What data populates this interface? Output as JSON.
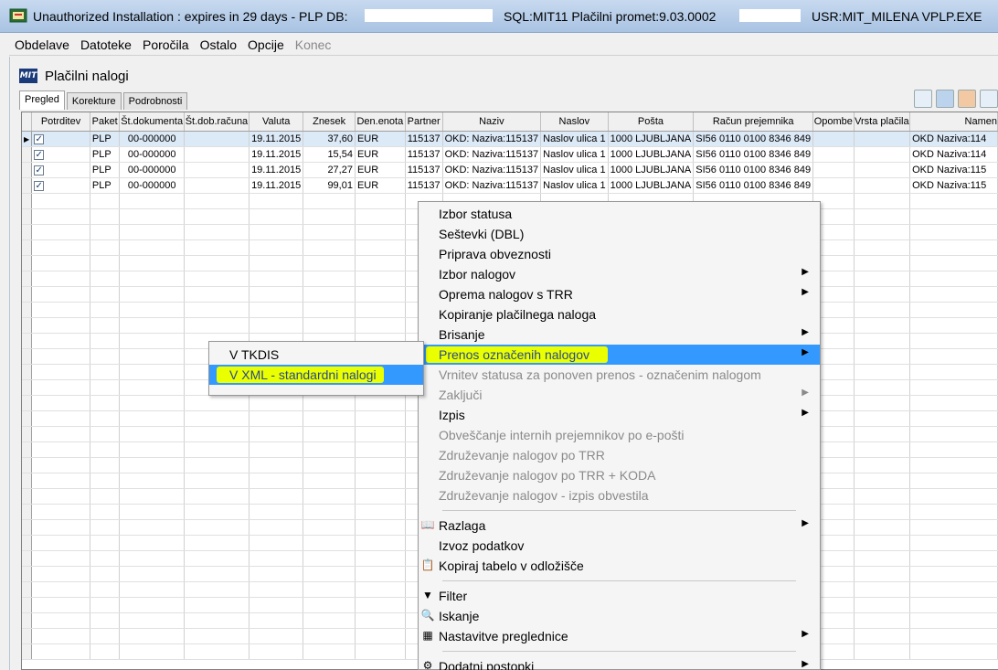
{
  "titlebar": {
    "title": "Unauthorized Installation : expires in 29 days - PLP   DB:",
    "sql": "SQL:MIT11   Plačilni promet:9.03.0002",
    "usr": "USR:MIT_MILENA   VPLP.EXE"
  },
  "menubar": [
    "Obdelave",
    "Datoteke",
    "Poročila",
    "Ostalo",
    "Opcije",
    "Konec"
  ],
  "window": {
    "logo": "MIT",
    "title": "Plačilni nalogi"
  },
  "tabs": [
    "Pregled",
    "Korekture",
    "Podrobnosti"
  ],
  "grid": {
    "columns": [
      "Potrditev",
      "Paket",
      "Št.dokumenta",
      "Št.dob.računa",
      "Valuta",
      "Znesek",
      "Den.enota",
      "Partner",
      "Naziv",
      "Naslov",
      "Pošta",
      "Račun prejemnika",
      "Opombe",
      "Vrsta plačila",
      "Namen"
    ],
    "rows": [
      [
        "✓",
        "PLP",
        "00-000000",
        "",
        "19.11.2015",
        "37,60",
        "EUR",
        "115137",
        "OKD: Naziva:115137",
        "Naslov ulica 1",
        "1000 LJUBLJANA",
        "SI56 0110 0100 8346 849",
        "",
        "",
        "OKD Naziva:114"
      ],
      [
        "✓",
        "PLP",
        "00-000000",
        "",
        "19.11.2015",
        "15,54",
        "EUR",
        "115137",
        "OKD: Naziva:115137",
        "Naslov ulica 1",
        "1000 LJUBLJANA",
        "SI56 0110 0100 8346 849",
        "",
        "",
        "OKD Naziva:114"
      ],
      [
        "✓",
        "PLP",
        "00-000000",
        "",
        "19.11.2015",
        "27,27",
        "EUR",
        "115137",
        "OKD: Naziva:115137",
        "Naslov ulica 1",
        "1000 LJUBLJANA",
        "SI56 0110 0100 8346 849",
        "",
        "",
        "OKD Naziva:115"
      ],
      [
        "✓",
        "PLP",
        "00-000000",
        "",
        "19.11.2015",
        "99,01",
        "EUR",
        "115137",
        "OKD: Naziva:115137",
        "Naslov ulica 1",
        "1000 LJUBLJANA",
        "SI56 0110 0100 8346 849",
        "",
        "",
        "OKD Naziva:115"
      ]
    ]
  },
  "context_menu": {
    "items": [
      {
        "label": "Izbor statusa"
      },
      {
        "label": "Seštevki (DBL)"
      },
      {
        "label": "Priprava obveznosti"
      },
      {
        "label": "Izbor nalogov",
        "submenu": true
      },
      {
        "label": "Oprema nalogov s TRR",
        "submenu": true
      },
      {
        "label": "Kopiranje plačilnega naloga"
      },
      {
        "label": "Brisanje",
        "submenu": true
      },
      {
        "label": "Prenos označenih nalogov",
        "submenu": true,
        "highlighted": true
      },
      {
        "label": "Vrnitev statusa za ponoven prenos - označenim nalogom",
        "disabled": true
      },
      {
        "label": "Zaključi",
        "submenu": true,
        "disabled": true
      },
      {
        "label": "Izpis",
        "submenu": true
      },
      {
        "label": "Obveščanje internih prejemnikov po e-pošti",
        "disabled": true
      },
      {
        "label": "Združevanje nalogov po TRR",
        "disabled": true
      },
      {
        "label": "Združevanje nalogov po TRR + KODA",
        "disabled": true
      },
      {
        "label": "Združevanje nalogov - izpis obvestila",
        "disabled": true
      },
      {
        "label": "Razlaga",
        "submenu": true,
        "icon": "help-book-icon"
      },
      {
        "label": "Izvoz podatkov"
      },
      {
        "label": "Kopiraj tabelo v odložišče",
        "icon": "copy-table-icon"
      },
      {
        "label": "Filter",
        "icon": "filter-icon"
      },
      {
        "label": "Iskanje",
        "icon": "search-icon"
      },
      {
        "label": "Nastavitve preglednice",
        "submenu": true,
        "icon": "grid-settings-icon"
      },
      {
        "label": "Dodatni postopki",
        "submenu": true,
        "icon": "gears-icon"
      }
    ]
  },
  "submenu": {
    "items": [
      {
        "label": "V TKDIS"
      },
      {
        "label": "V XML - standardni nalogi",
        "highlighted": true
      }
    ]
  },
  "colors": {
    "highlight": "#3399ff",
    "marker": "#eaff00",
    "selected_row": "#dce9f7"
  }
}
